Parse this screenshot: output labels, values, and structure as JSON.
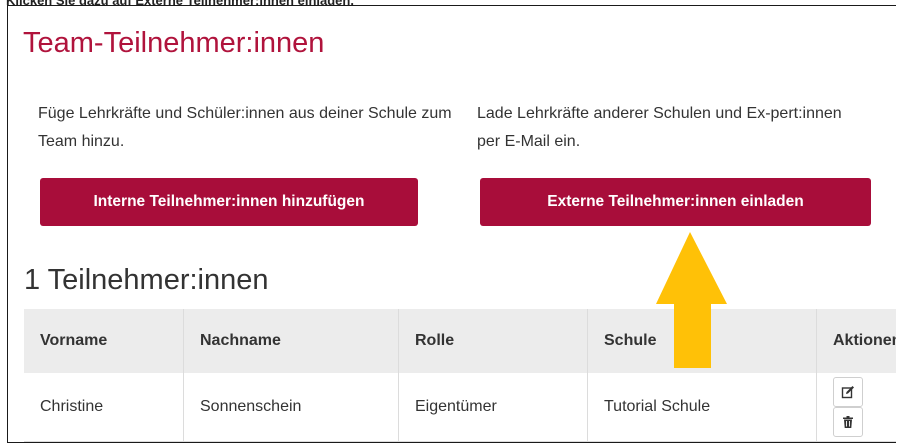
{
  "instruction_text": "Klicken Sie dazu auf Externe Teilnehmer:innen einladen.",
  "section": {
    "title": "Team-Teilnehmer:innen",
    "internal_description": "Füge Lehrkräfte und Schüler:innen aus deiner Schule zum Team hinzu.",
    "external_description": "Lade Lehrkräfte anderer Schulen und Ex-pert:innen per E-Mail ein.",
    "internal_button_label": "Interne Teilnehmer:innen hinzufügen",
    "external_button_label": "Externe Teilnehmer:innen einladen"
  },
  "participants": {
    "count_heading": "1 Teilnehmer:innen",
    "columns": [
      "Vorname",
      "Nachname",
      "Rolle",
      "Schule",
      "Aktionen"
    ],
    "rows": [
      {
        "first_name": "Christine",
        "last_name": "Sonnenschein",
        "role": "Eigentümer",
        "school": "Tutorial Schule"
      }
    ]
  },
  "colors": {
    "brand": "#a80d3a",
    "title": "#b0133c",
    "arrow": "#ffc107",
    "header_bg": "#ececec"
  },
  "icons": [
    "edit-icon",
    "trash-icon",
    "arrow-up-icon"
  ]
}
